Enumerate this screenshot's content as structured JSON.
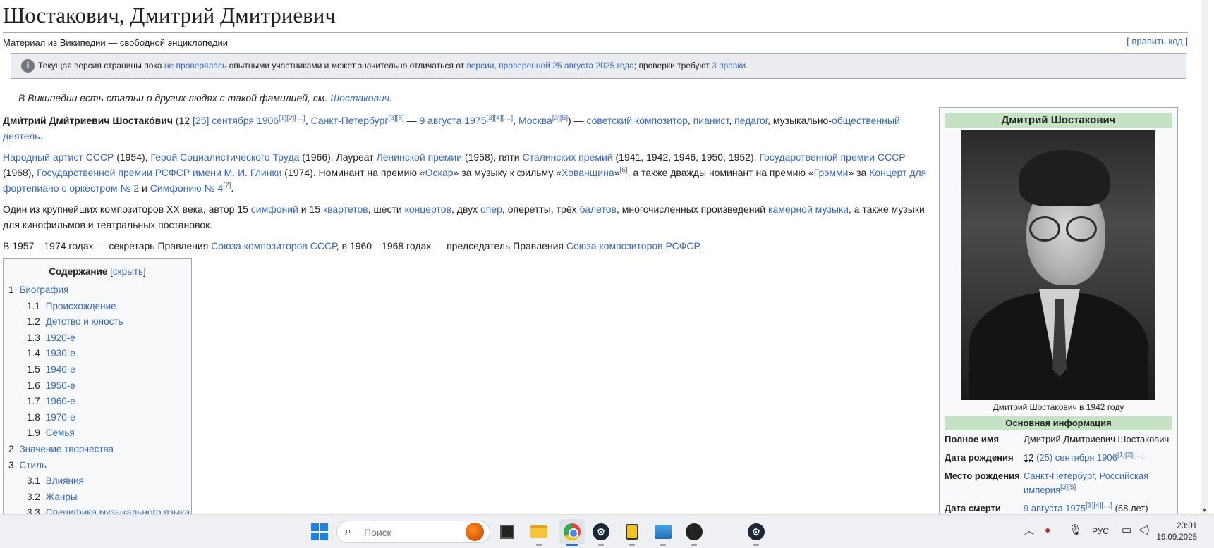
{
  "article": {
    "title": "Шостакович, Дмитрий Дмитриевич",
    "subtitle": "Материал из Википедии — свободной энциклопедии",
    "edit_link": "[ править код ]",
    "notice": {
      "t1": "Текущая версия страницы пока ",
      "l1": "не проверялась",
      "t2": " опытными участниками и может значительно отличаться от ",
      "l2": "версии, проверенной 25 августа 2025 года",
      "t3": "; проверки требуют ",
      "l3": "3 правки",
      "t4": "."
    },
    "hatnote": {
      "text": "В Википедии есть статьи о других людях с такой фамилией, см. ",
      "link": "Шостакович",
      "end": "."
    },
    "p1": {
      "name": "Дми́трий Дми́триевич Шостако́вич",
      "a": " (",
      "date_ul": "12",
      "b": " ",
      "date_link": "[25] сентября 1906",
      "ref1": "[1][2][…]",
      "c": ", ",
      "birth_place": "Санкт-Петербург",
      "ref2": "[3][5]",
      "d": " — ",
      "death_date": "9 августа 1975",
      "ref3": "[3][4][…]",
      "e": ", ",
      "death_place": "Москва",
      "ref4": "[3][5]",
      "f": ") — ",
      "occ1": "советский композитор",
      "g": ", ",
      "occ2": "пианист",
      "h": ", ",
      "occ3": "педагог",
      "i": ", музыкально-",
      "occ4": "общественный деятель",
      "j": "."
    },
    "p2": {
      "l1": "Народный артист СССР",
      "t1": " (1954), ",
      "l2": "Герой Социалистического Труда",
      "t2": " (1966). Лауреат ",
      "l3": "Ленинской премии",
      "t3": " (1958), пяти ",
      "l4": "Сталинских премий",
      "t4": " (1941, 1942, 1946, 1950, 1952), ",
      "l5": "Государственной премии СССР",
      "t5": " (1968), ",
      "l6": "Государственной премии РСФСР имени М. И. Глинки",
      "t6": " (1974). Номинант на премию «",
      "l7": "Оскар",
      "t7": "» за музыку к фильму «",
      "l8": "Хованщина",
      "t8": "»",
      "r1": "[6]",
      "t9": ", а также дважды номинант на премию «",
      "l9": "Грэмми",
      "t10": "» за ",
      "l10": "Концерт для фортепиано с оркестром № 2",
      "t11": " и ",
      "l11": "Симфонию № 4",
      "r2": "[7]",
      "t12": "."
    },
    "p3": {
      "t1": "Один из крупнейших композиторов XX века, автор 15 ",
      "l1": "симфоний",
      "t2": " и 15 ",
      "l2": "квартетов",
      "t3": ", шести ",
      "l3": "концертов",
      "t4": ", двух ",
      "l4": "опер",
      "t5": ", оперетты, трёх ",
      "l5": "балетов",
      "t6": ", многочисленных произведений ",
      "l6": "камерной музыки",
      "t7": ", а также музыки для кинофильмов и театральных постановок."
    },
    "p4": {
      "t1": "В 1957—1974 годах — секретарь Правления ",
      "l1": "Союза композиторов СССР",
      "t2": ", в 1960—1968 годах — председатель Правления ",
      "l2": "Союза композиторов РСФСР",
      "t3": "."
    }
  },
  "toc": {
    "title": "Содержание",
    "toggle_open": " [",
    "toggle": "скрыть",
    "toggle_close": "]",
    "items": [
      {
        "num": "1",
        "label": "Биография"
      },
      {
        "num": "1.1",
        "label": "Происхождение"
      },
      {
        "num": "1.2",
        "label": "Детство и юность"
      },
      {
        "num": "1.3",
        "label": "1920-е"
      },
      {
        "num": "1.4",
        "label": "1930-е"
      },
      {
        "num": "1.5",
        "label": "1940-е"
      },
      {
        "num": "1.6",
        "label": "1950-е"
      },
      {
        "num": "1.7",
        "label": "1960-е"
      },
      {
        "num": "1.8",
        "label": "1970-е"
      },
      {
        "num": "1.9",
        "label": "Семья"
      },
      {
        "num": "2",
        "label": "Значение творчества"
      },
      {
        "num": "3",
        "label": "Стиль"
      },
      {
        "num": "3.1",
        "label": "Влияния"
      },
      {
        "num": "3.2",
        "label": "Жанры"
      },
      {
        "num": "3.3",
        "label": "Специфика музыкального языка"
      }
    ]
  },
  "infobox": {
    "title": "Дмитрий Шостакович",
    "caption": "Дмитрий Шостакович в 1942 году",
    "section": "Основная информация",
    "full_name_label": "Полное имя",
    "full_name": "Дмитрий Дмитриевич Шостакович",
    "birth_label": "Дата рождения",
    "birth_ul": "12",
    "birth_link": " (25) сентября 1906",
    "birth_ref": "[1][2][…]",
    "birthplace_label": "Место рождения",
    "birthplace": "Санкт-Петербург, Российская империя",
    "birthplace_ref": "[3][5]",
    "death_label": "Дата смерти",
    "death_link": "9 августа 1975",
    "death_ref": "[3][4][…]",
    "death_age": " (68 лет)"
  },
  "taskbar": {
    "search_placeholder": "Поиск",
    "lang": "РУС",
    "time": "23:01",
    "date": "19.09.2025"
  },
  "colors": {
    "link": "#3366cc",
    "infobox_header": "#c5e2c5",
    "accent": "#1f6fd1"
  }
}
